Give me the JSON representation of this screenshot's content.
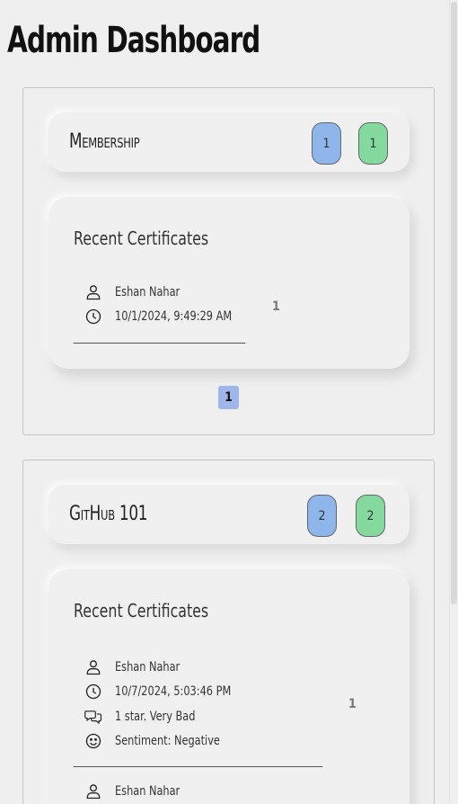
{
  "page_title": "Admin Dashboard",
  "courses": [
    {
      "name": "Membership",
      "badge_blue": "1",
      "badge_green": "1",
      "card_title": "Recent Certificates",
      "certificates": [
        {
          "user": "Eshan Nahar",
          "time": "10/1/2024, 9:49:29 AM",
          "count": "1"
        }
      ],
      "pagination": [
        "1"
      ]
    },
    {
      "name": "GitHub 101",
      "badge_blue": "2",
      "badge_green": "2",
      "card_title": "Recent Certificates",
      "certificates": [
        {
          "user": "Eshan Nahar",
          "time": "10/7/2024, 5:03:46 PM",
          "feedback": "1 star. Very Bad",
          "sentiment": "Sentiment: Negative",
          "count": "1"
        },
        {
          "user": "Eshan Nahar"
        }
      ]
    }
  ],
  "colors": {
    "badge_blue": "#8fb6ea",
    "badge_green": "#84da9e",
    "page_button": "#9fb6ea",
    "background": "#efefef"
  },
  "icons": {
    "user": "user-icon",
    "clock": "clock-icon",
    "comments": "comments-icon",
    "smile": "smile-icon"
  }
}
